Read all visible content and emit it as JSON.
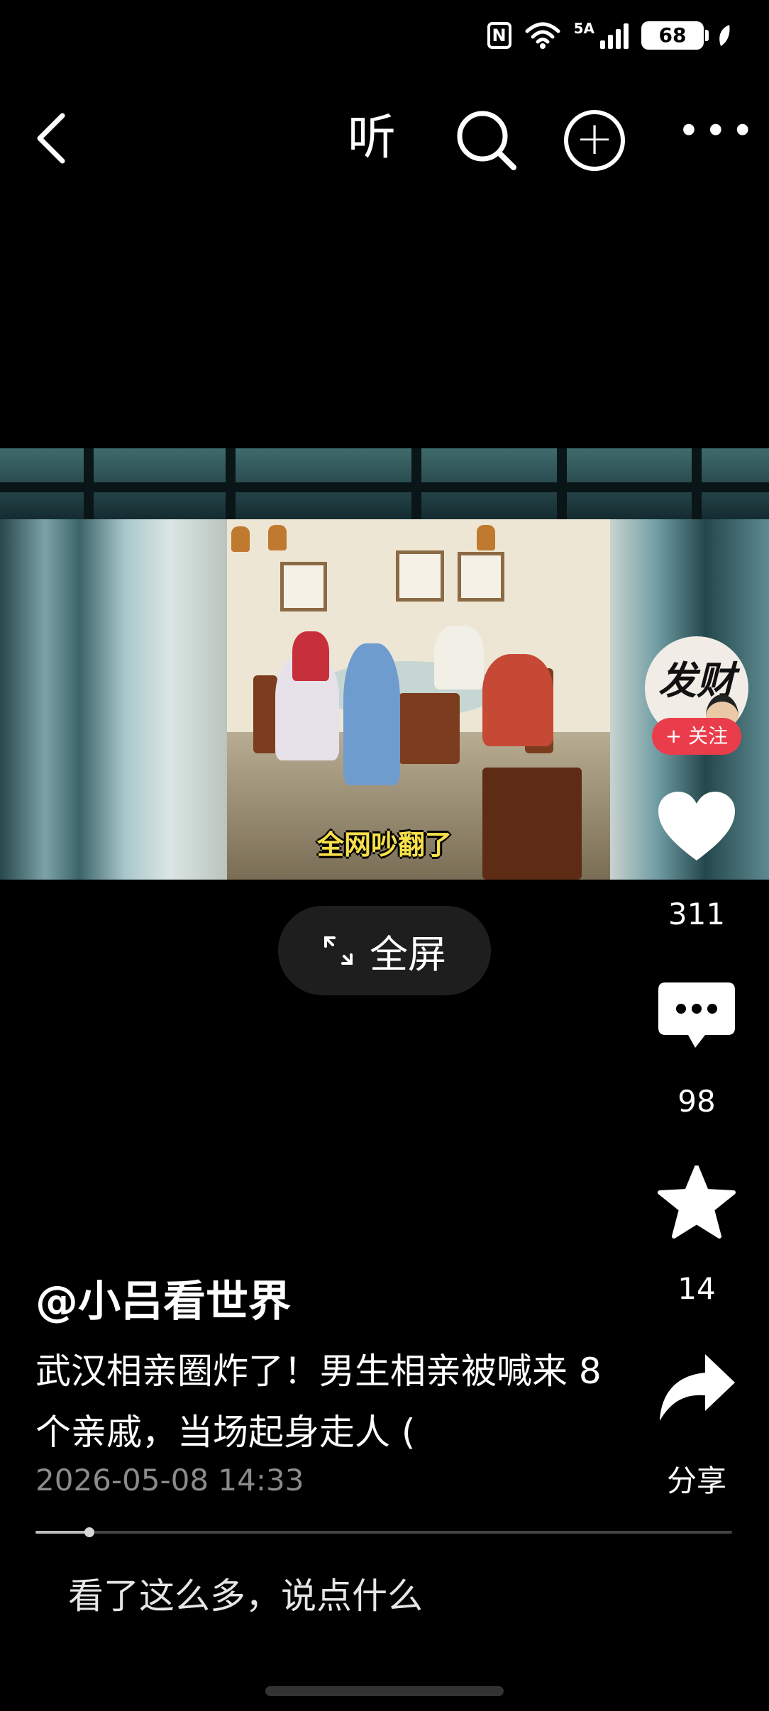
{
  "status_bar": {
    "left_text": "",
    "network_label": "5A",
    "battery_level": "68"
  },
  "nav": {
    "listen_label": "听"
  },
  "video": {
    "subtitle": "全网吵翻了",
    "fullscreen_label": "全屏"
  },
  "rail": {
    "avatar_text": "发财",
    "follow_label": "+ 关注",
    "like_count": "311",
    "comment_count": "98",
    "favorite_count": "14",
    "share_label": "分享"
  },
  "post": {
    "author": "@小吕看世界",
    "description": "武汉相亲圈炸了！男生相亲被喊来 8 个亲戚，当场起身走人 (",
    "date": "2026-05-08 14:33",
    "progress": 0.077
  },
  "comment_box": {
    "placeholder": "看了这么多，说点什么"
  },
  "colors": {
    "follow": "#ea3d4c",
    "background": "#000000",
    "subtitle": "#f7e04a"
  }
}
